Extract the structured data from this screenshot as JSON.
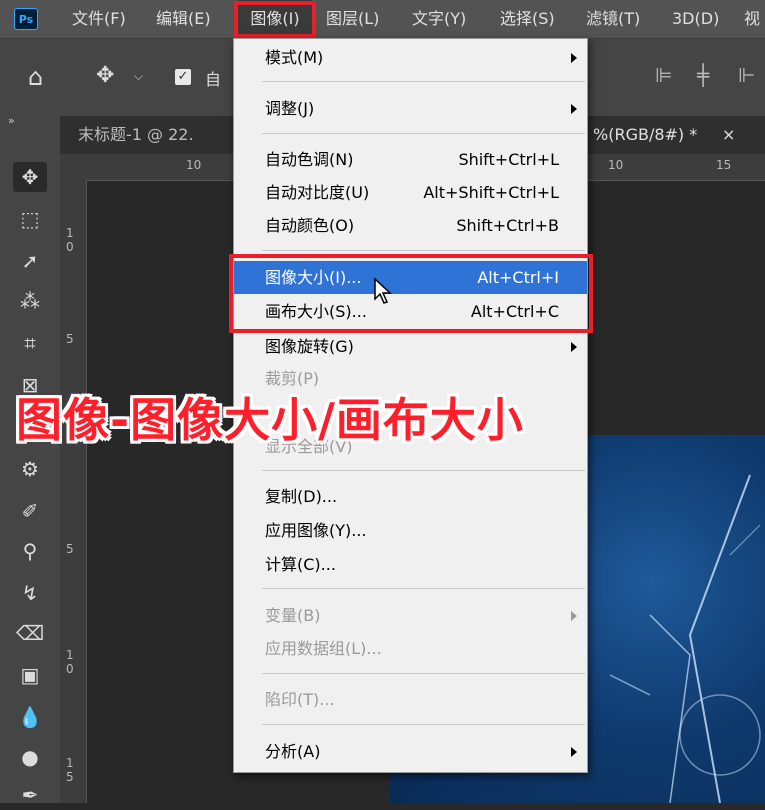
{
  "menubar": {
    "logo": "Ps",
    "items": [
      {
        "label": "文件(F)"
      },
      {
        "label": "编辑(E)"
      },
      {
        "label": "图像(I)"
      },
      {
        "label": "图层(L)"
      },
      {
        "label": "文字(Y)"
      },
      {
        "label": "选择(S)"
      },
      {
        "label": "滤镜(T)"
      },
      {
        "label": "3D(D)"
      },
      {
        "label": "视"
      }
    ]
  },
  "options": {
    "auto_select_label": "自"
  },
  "tabs": {
    "left": "末标题-1 @ 22.",
    "right": "%(RGB/8#) *",
    "close": "×"
  },
  "rulers": {
    "top": [
      "10",
      "10",
      "15"
    ],
    "left": [
      "1",
      "0",
      "5",
      "5",
      "1",
      "0",
      "1",
      "5"
    ]
  },
  "image_menu": {
    "items": [
      {
        "label": "模式(M)",
        "shortcut": "",
        "submenu": true,
        "disabled": false
      },
      {
        "label": "调整(J)",
        "shortcut": "",
        "submenu": true,
        "disabled": false
      },
      {
        "label": "自动色调(N)",
        "shortcut": "Shift+Ctrl+L",
        "submenu": false,
        "disabled": false
      },
      {
        "label": "自动对比度(U)",
        "shortcut": "Alt+Shift+Ctrl+L",
        "submenu": false,
        "disabled": false
      },
      {
        "label": "自动颜色(O)",
        "shortcut": "Shift+Ctrl+B",
        "submenu": false,
        "disabled": false
      },
      {
        "label": "图像大小(I)...",
        "shortcut": "Alt+Ctrl+I",
        "submenu": false,
        "disabled": false,
        "highlighted": true
      },
      {
        "label": "画布大小(S)...",
        "shortcut": "Alt+Ctrl+C",
        "submenu": false,
        "disabled": false
      },
      {
        "label": "图像旋转(G)",
        "shortcut": "",
        "submenu": true,
        "disabled": false
      },
      {
        "label": "裁剪(P)",
        "shortcut": "",
        "submenu": false,
        "disabled": true
      },
      {
        "label": "显示全部(V)",
        "shortcut": "",
        "submenu": false,
        "disabled": true
      },
      {
        "label": "复制(D)...",
        "shortcut": "",
        "submenu": false,
        "disabled": false
      },
      {
        "label": "应用图像(Y)...",
        "shortcut": "",
        "submenu": false,
        "disabled": false
      },
      {
        "label": "计算(C)...",
        "shortcut": "",
        "submenu": false,
        "disabled": false
      },
      {
        "label": "变量(B)",
        "shortcut": "",
        "submenu": true,
        "disabled": true
      },
      {
        "label": "应用数据组(L)...",
        "shortcut": "",
        "submenu": false,
        "disabled": true
      },
      {
        "label": "陷印(T)...",
        "shortcut": "",
        "submenu": false,
        "disabled": true
      },
      {
        "label": "分析(A)",
        "shortcut": "",
        "submenu": true,
        "disabled": false
      }
    ]
  },
  "overlay_caption": "图像-图像大小/画布大小",
  "colors": {
    "highlight": "#2f73d6",
    "annotation_red": "#e8202a",
    "menu_bg": "#f0f0f0",
    "ps_dark": "#535353"
  }
}
